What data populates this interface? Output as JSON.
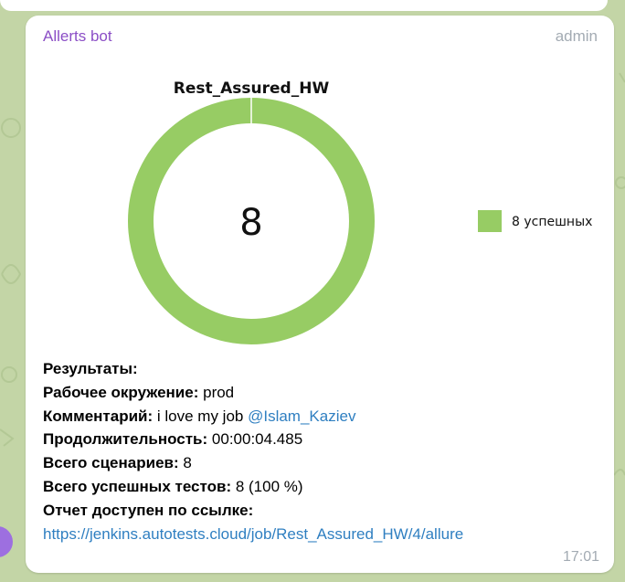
{
  "message": {
    "sender": "Allerts bot",
    "role": "admin",
    "time": "17:01"
  },
  "chart_data": {
    "type": "pie",
    "title": "Rest_Assured_HW",
    "center_label": "8",
    "series": [
      {
        "name": "8 успешных",
        "value": 8,
        "color": "#97cc64"
      }
    ],
    "legend_position": "right"
  },
  "results": {
    "heading": "Результаты:",
    "env_label": "Рабочее окружение:",
    "env_value": "prod",
    "comment_label": "Комментарий:",
    "comment_value": "i love my job",
    "mention": "@Islam_Kaziev",
    "duration_label": "Продолжительность:",
    "duration_value": "00:00:04.485",
    "scenarios_label": "Всего сценариев:",
    "scenarios_value": "8",
    "passed_label": "Всего успешных тестов:",
    "passed_value": "8 (100 %)",
    "report_label": "Отчет доступен по ссылке:",
    "report_link": "https://jenkins.autotests.cloud/job/Rest_Assured_HW/4/allure"
  }
}
